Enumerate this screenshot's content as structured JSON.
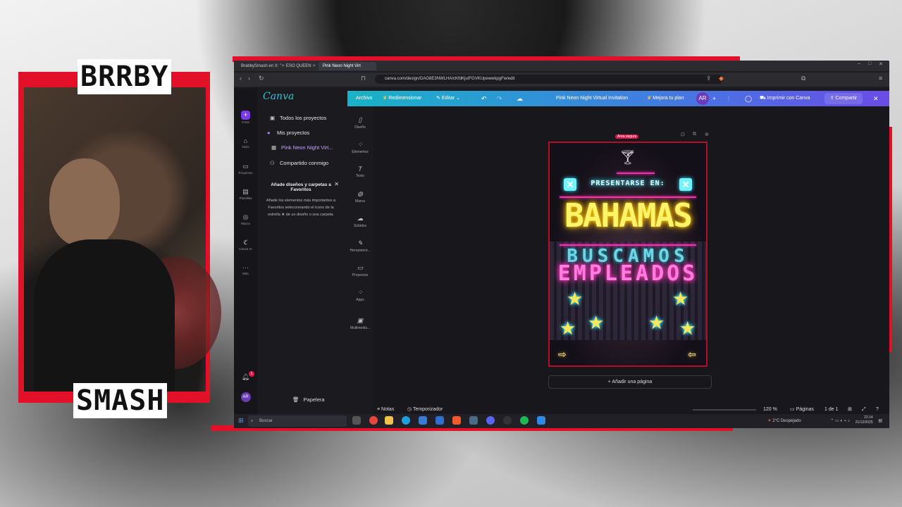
{
  "overlay": {
    "brand_top": "BRRBY",
    "brand_bottom": "SMASH"
  },
  "browser": {
    "tabs": [
      {
        "label": "BrabbySmash en X: \"✧ ESO QUEEN ✧"
      },
      {
        "label": "Pink Neon Night Virt"
      }
    ],
    "url": "canva.com/design/DAG8E3NWLHA/cKfdKjuIFGVKUpewwkpgFw/edit"
  },
  "canva": {
    "logo": "Canva",
    "rail": [
      {
        "label": "Crear"
      },
      {
        "label": "Inicio"
      },
      {
        "label": "Proyectos"
      },
      {
        "label": "Plantillas"
      },
      {
        "label": "Marca"
      },
      {
        "label": "Canva IA"
      },
      {
        "label": "Más"
      }
    ],
    "nav": {
      "all_projects": "Todos los proyectos",
      "my_projects": "Mis proyectos",
      "current_design": "Pink Neon Night Virt...",
      "shared": "Compartido conmigo",
      "trash": "Papelera"
    },
    "favorites_card": {
      "title": "Añade diseños y carpetas a Favoritos",
      "body": "Añade los elementos más importantes a Favoritos seleccionando el icono de la estrella ★ de un diseño o una carpeta."
    },
    "tools": [
      {
        "label": "Diseño"
      },
      {
        "label": "Elementos"
      },
      {
        "label": "Texto"
      },
      {
        "label": "Marca"
      },
      {
        "label": "Subidos"
      },
      {
        "label": "Herramient..."
      },
      {
        "label": "Proyectos"
      },
      {
        "label": "Apps"
      },
      {
        "label": "Multimedia..."
      }
    ],
    "topbar": {
      "file": "Archivo",
      "resize": "Redimensionar",
      "edit": "Editar",
      "title": "Pink Neon Night Virtual Invitation",
      "upgrade": "Mejora tu plan",
      "avatar": "AR",
      "print": "Imprimir con Canva",
      "share": "Compartir"
    },
    "poster": {
      "safe_area": "Área segura",
      "line1": "PRESENTARSE EN:",
      "line2": "BAHAMAS",
      "line3": "BUSCAMOS",
      "line4": "EMPLEADOS"
    },
    "add_page": "+ Añadir una página",
    "bottom": {
      "notes": "Notas",
      "timer": "Temporizador",
      "zoom": "120 %",
      "pages_label": "Páginas",
      "page_count": "1 de 1"
    },
    "notification_count": "1",
    "user_avatar": "AR"
  },
  "taskbar": {
    "search_placeholder": "Buscar",
    "weather": "2°C Despejado",
    "time": "22:14",
    "date": "21/12/2025"
  },
  "colors": {
    "accent_red": "#e3102a",
    "canva_gradient_start": "#19b3c6",
    "canva_gradient_end": "#6a4ce6"
  }
}
